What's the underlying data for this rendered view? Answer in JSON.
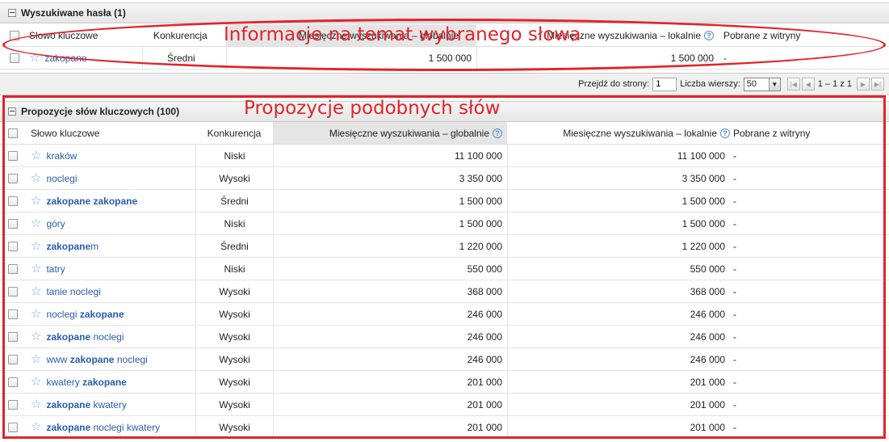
{
  "top_panel": {
    "title": "Wyszukiwane hasła (1)",
    "columns": {
      "keyword": "Słowo kluczowe",
      "competition": "Konkurencja",
      "global": "Miesięczne wyszukiwania – globalnie",
      "local": "Miesięczne wyszukiwania – lokalnie",
      "extracted": "Pobrane z witryny"
    },
    "row": {
      "keyword": "zakopane",
      "competition": "Średni",
      "global": "1 500 000",
      "local": "1 500 000",
      "extracted": "-"
    }
  },
  "pager": {
    "goto_label": "Przejdź do strony:",
    "page_value": "1",
    "rows_label": "Liczba wierszy:",
    "rows_value": "50",
    "range": "1 – 1 z 1"
  },
  "suggestions_panel": {
    "title": "Propozycje słów kluczowych (100)",
    "columns": {
      "keyword": "Słowo kluczowe",
      "competition": "Konkurencja",
      "global": "Miesięczne wyszukiwania – globalnie",
      "local": "Miesięczne wyszukiwania – lokalnie",
      "extracted": "Pobrane z witryny"
    },
    "rows": [
      {
        "keyword": [
          {
            "t": "kraków",
            "b": false
          }
        ],
        "competition": "Niski",
        "global": "11 100 000",
        "local": "11 100 000",
        "extracted": "-"
      },
      {
        "keyword": [
          {
            "t": "noclegi",
            "b": false
          }
        ],
        "competition": "Wysoki",
        "global": "3 350 000",
        "local": "3 350 000",
        "extracted": "-"
      },
      {
        "keyword": [
          {
            "t": "zakopane zakopane",
            "b": true
          }
        ],
        "competition": "Średni",
        "global": "1 500 000",
        "local": "1 500 000",
        "extracted": "-"
      },
      {
        "keyword": [
          {
            "t": "góry",
            "b": false
          }
        ],
        "competition": "Niski",
        "global": "1 500 000",
        "local": "1 500 000",
        "extracted": "-"
      },
      {
        "keyword": [
          {
            "t": "zakopane",
            "b": true
          },
          {
            "t": "m",
            "b": false
          }
        ],
        "competition": "Średni",
        "global": "1 220 000",
        "local": "1 220 000",
        "extracted": "-"
      },
      {
        "keyword": [
          {
            "t": "tatry",
            "b": false
          }
        ],
        "competition": "Niski",
        "global": "550 000",
        "local": "550 000",
        "extracted": "-"
      },
      {
        "keyword": [
          {
            "t": "tanie noclegi",
            "b": false
          }
        ],
        "competition": "Wysoki",
        "global": "368 000",
        "local": "368 000",
        "extracted": "-"
      },
      {
        "keyword": [
          {
            "t": "noclegi ",
            "b": false
          },
          {
            "t": "zakopane",
            "b": true
          }
        ],
        "competition": "Wysoki",
        "global": "246 000",
        "local": "246 000",
        "extracted": "-"
      },
      {
        "keyword": [
          {
            "t": "zakopane",
            "b": true
          },
          {
            "t": " noclegi",
            "b": false
          }
        ],
        "competition": "Wysoki",
        "global": "246 000",
        "local": "246 000",
        "extracted": "-"
      },
      {
        "keyword": [
          {
            "t": "www ",
            "b": false
          },
          {
            "t": "zakopane",
            "b": true
          },
          {
            "t": " noclegi",
            "b": false
          }
        ],
        "competition": "Wysoki",
        "global": "246 000",
        "local": "246 000",
        "extracted": "-"
      },
      {
        "keyword": [
          {
            "t": "kwatery ",
            "b": false
          },
          {
            "t": "zakopane",
            "b": true
          }
        ],
        "competition": "Wysoki",
        "global": "201 000",
        "local": "201 000",
        "extracted": "-"
      },
      {
        "keyword": [
          {
            "t": "zakopane",
            "b": true
          },
          {
            "t": " kwatery",
            "b": false
          }
        ],
        "competition": "Wysoki",
        "global": "201 000",
        "local": "201 000",
        "extracted": "-"
      },
      {
        "keyword": [
          {
            "t": "zakopane",
            "b": true
          },
          {
            "t": " noclegi kwatery",
            "b": false
          }
        ],
        "competition": "Wysoki",
        "global": "201 000",
        "local": "201 000",
        "extracted": "-"
      }
    ]
  },
  "annotations": {
    "top": "Informacje na temat wybranego słowa",
    "bottom": "Propozycje podobnych słów",
    "color": "#e0242b"
  },
  "icons": {
    "star": "star-icon",
    "help": "help-icon",
    "collapse": "collapse-icon"
  }
}
